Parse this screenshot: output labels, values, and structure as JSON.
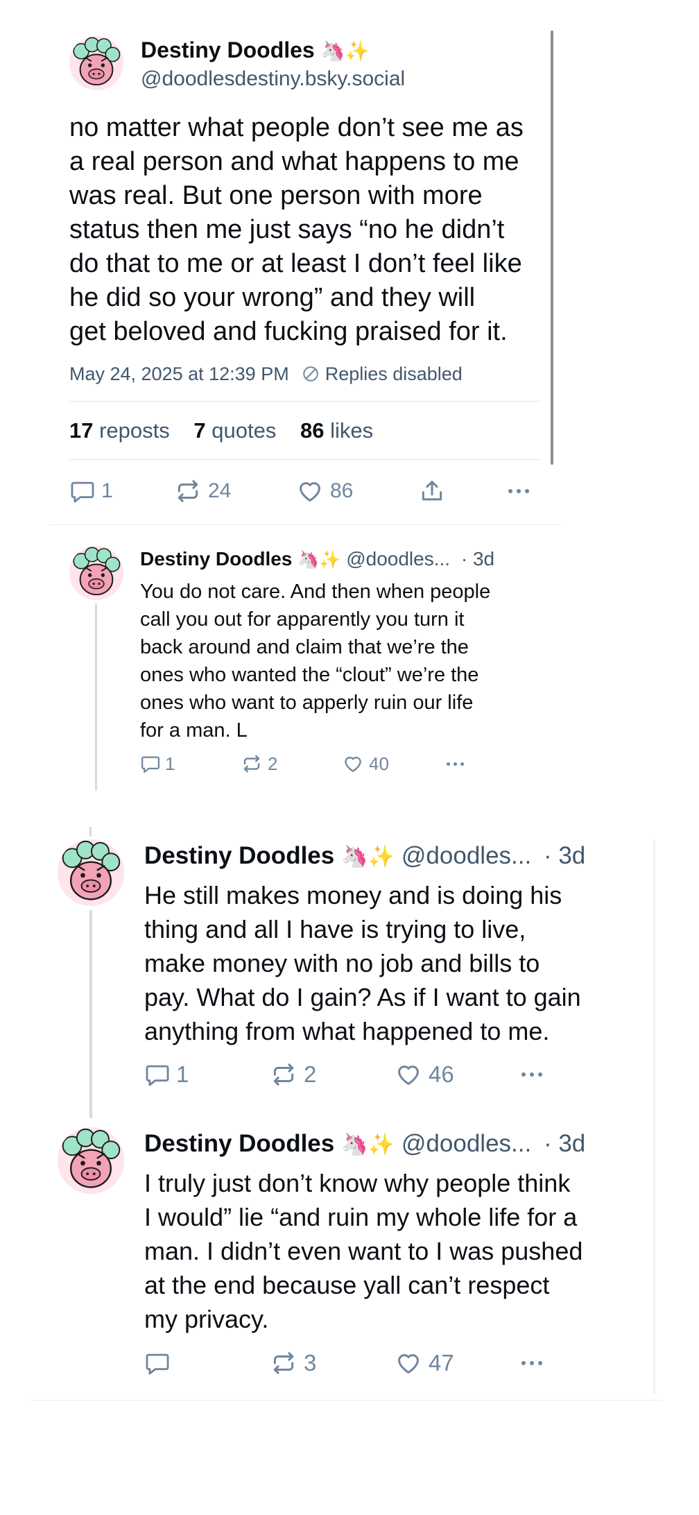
{
  "main_post": {
    "author_name": "Destiny Doodles",
    "author_emoji": "🦄✨",
    "author_handle": "@doodlesdestiny.bsky.social",
    "text_lines": [
      "no matter what people don’t see me as",
      "a real person and what happens to me",
      "was real. But one person with more",
      "status then me just says “no he didn’t",
      "do that to me or at least I don’t feel like",
      "he did so your wrong”  and they will",
      "get beloved and fucking praised for it."
    ],
    "timestamp": "May 24, 2025 at 12:39 PM",
    "replies_status": "Replies disabled",
    "stats": {
      "reposts_count": "17",
      "reposts_label": "reposts",
      "quotes_count": "7",
      "quotes_label": "quotes",
      "likes_count": "86",
      "likes_label": "likes"
    },
    "actions": {
      "reply": "1",
      "repost": "24",
      "like": "86"
    }
  },
  "reply_1": {
    "author_name": "Destiny Doodles",
    "author_emoji": "🦄✨",
    "handle_short": "@doodles...",
    "age": "· 3d",
    "text_lines": [
      "You do not care. And then when people",
      "call you out for apparently you turn it",
      "back around and claim that we’re the",
      "ones who wanted the “clout” we’re the",
      "ones who want to apperly ruin our life",
      "for a man. L"
    ],
    "actions": {
      "reply": "1",
      "repost": "2",
      "like": "40"
    }
  },
  "reply_2": {
    "author_name": "Destiny Doodles",
    "author_emoji": "🦄✨",
    "handle_short": "@doodles...",
    "age": "· 3d",
    "text_lines": [
      "He still makes money and is doing his",
      "thing and all I have is trying to live,",
      "make money with no job and bills to",
      "pay. What do I gain? As if I want to gain",
      "anything from what happened to me."
    ],
    "actions": {
      "reply": "1",
      "repost": "2",
      "like": "46"
    }
  },
  "reply_3": {
    "author_name": "Destiny Doodles",
    "author_emoji": "🦄✨",
    "handle_short": "@doodles...",
    "age": "· 3d",
    "text_lines": [
      "I truly just don’t know why people think",
      "I would” lie “and ruin my whole life for a",
      "man. I didn’t even want to I was pushed",
      "at the end because yall can’t respect",
      "my privacy."
    ],
    "actions": {
      "reply": "",
      "repost": "3",
      "like": "47"
    }
  },
  "colors": {
    "text": "#0b0f14",
    "muted": "#42576c",
    "icon": "#6f869f",
    "thread_line": "#d4dbe2",
    "avatar_bg": "#ffe4ec",
    "avatar_pink": "#f3a3b6",
    "avatar_mint": "#9fe3c8"
  },
  "icons": {
    "reply": "speech-bubble-icon",
    "repost": "repost-arrows-icon",
    "like": "heart-icon",
    "share": "share-upload-icon",
    "more": "ellipsis-icon",
    "replies_disabled": "prohibited-circle-icon"
  }
}
